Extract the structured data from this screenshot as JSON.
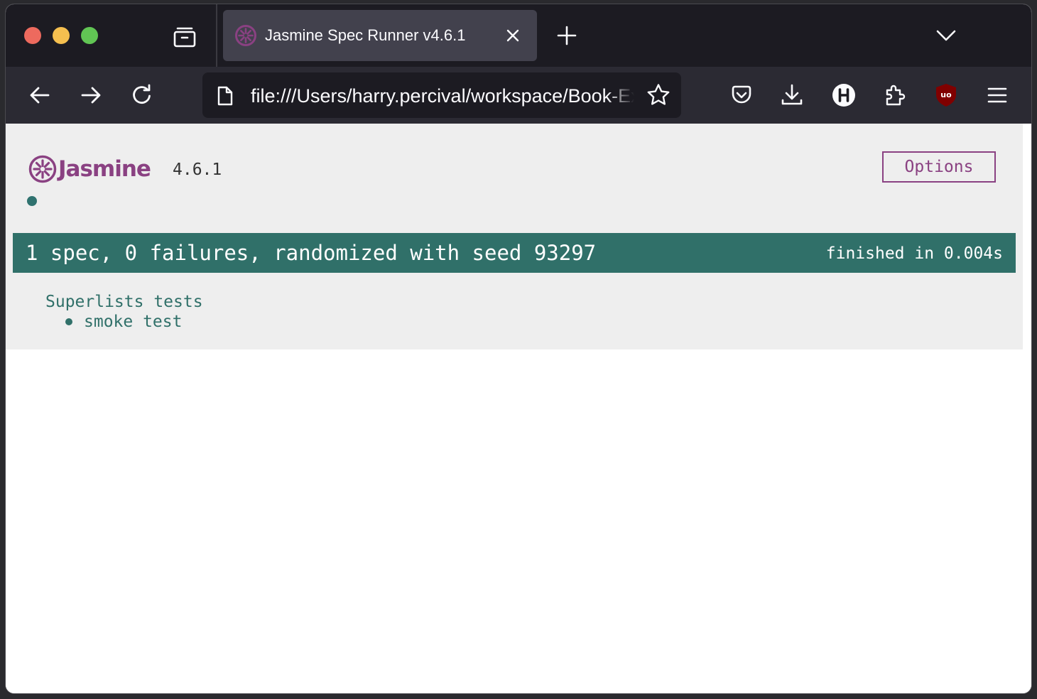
{
  "browser": {
    "tab": {
      "title": "Jasmine Spec Runner v4.6.1"
    },
    "url": "file:///Users/harry.percival/workspace/Book-Example/src/lists/static/tests/SpecRunner.html",
    "toolbar_icons": [
      "back-icon",
      "forward-icon",
      "reload-icon",
      "pocket-icon",
      "download-icon",
      "h-extension-icon",
      "extensions-icon",
      "ublock-icon",
      "menu-icon"
    ],
    "colors": {
      "tabstrip": "#1c1b22",
      "navbar": "#2b2a33",
      "active_tab": "#42414d"
    }
  },
  "jasmine": {
    "logo_text": "Jasmine",
    "version": "4.6.1",
    "options_label": "Options",
    "summary": "1 spec, 0 failures, randomized with seed 93297",
    "duration": "finished in 0.004s",
    "suite": {
      "name": "Superlists tests",
      "specs": [
        "smoke test"
      ]
    },
    "colors": {
      "brand": "#8a4182",
      "passed": "#307069",
      "background": "#eeeeee"
    }
  }
}
